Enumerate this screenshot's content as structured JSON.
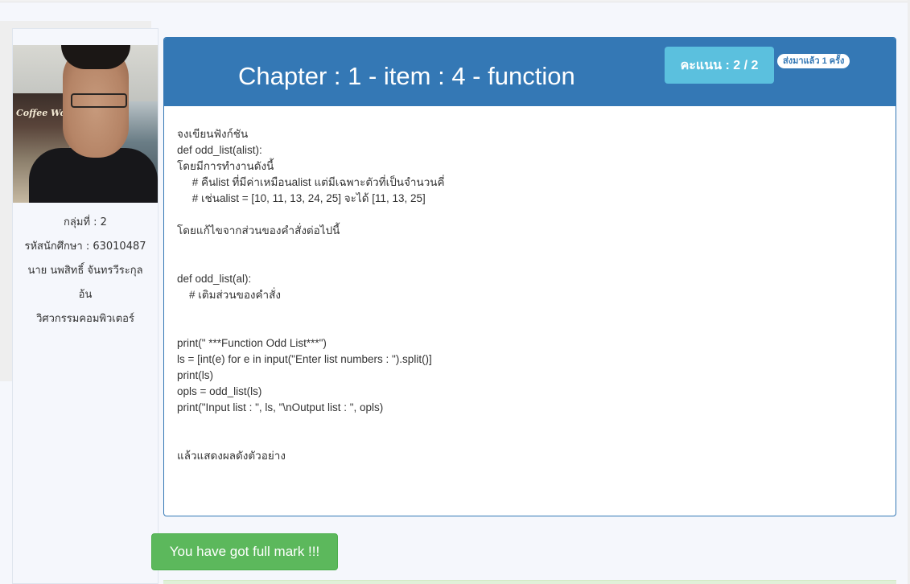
{
  "student": {
    "group": "กลุ่มที่ : 2",
    "student_id": "รหัสนักศึกษา : 63010487",
    "name": "นาย นพสิทธิ์ จันทรวีระกุล",
    "name_cont": "อ้น",
    "major": "วิศวกรรมคอมพิวเตอร์"
  },
  "header": {
    "title": "Chapter : 1 - item : 4 - function",
    "score": "คะแนน : 2 / 2",
    "sent_badge": "ส่งมาแล้ว 1 ครั้ง"
  },
  "problem_lines": [
    "จงเขียนฟังก์ชัน",
    "def odd_list(alist):",
    "โดยมีการทำงานดังนี้",
    "     # คืนlist ที่มีค่าเหมือนalist แต่มีเฉพาะตัวที่เป็นจำนวนคี่",
    "     # เช่นalist = [10, 11, 13, 24, 25] จะได้ [11, 13, 25]",
    "",
    "โดยแก้ไขจากส่วนของคำสั่งต่อไปนี้",
    "",
    "",
    "def odd_list(al):",
    "    # เติมส่วนของคำสั่ง",
    "",
    "",
    "print(\" ***Function Odd List***\")",
    "ls = [int(e) for e in input(\"Enter list numbers : \").split()]",
    "print(ls)",
    "opls = odd_list(ls)",
    "print(\"Input list : \", ls, \"\\nOutput list : \", opls)",
    "",
    "",
    "แล้วแสดงผลดังตัวอย่าง"
  ],
  "result": {
    "message": "You have got full mark !!!"
  },
  "colors": {
    "header_blue": "#3478b5",
    "score_cyan": "#5bc0de",
    "success_green": "#5cb85c"
  }
}
